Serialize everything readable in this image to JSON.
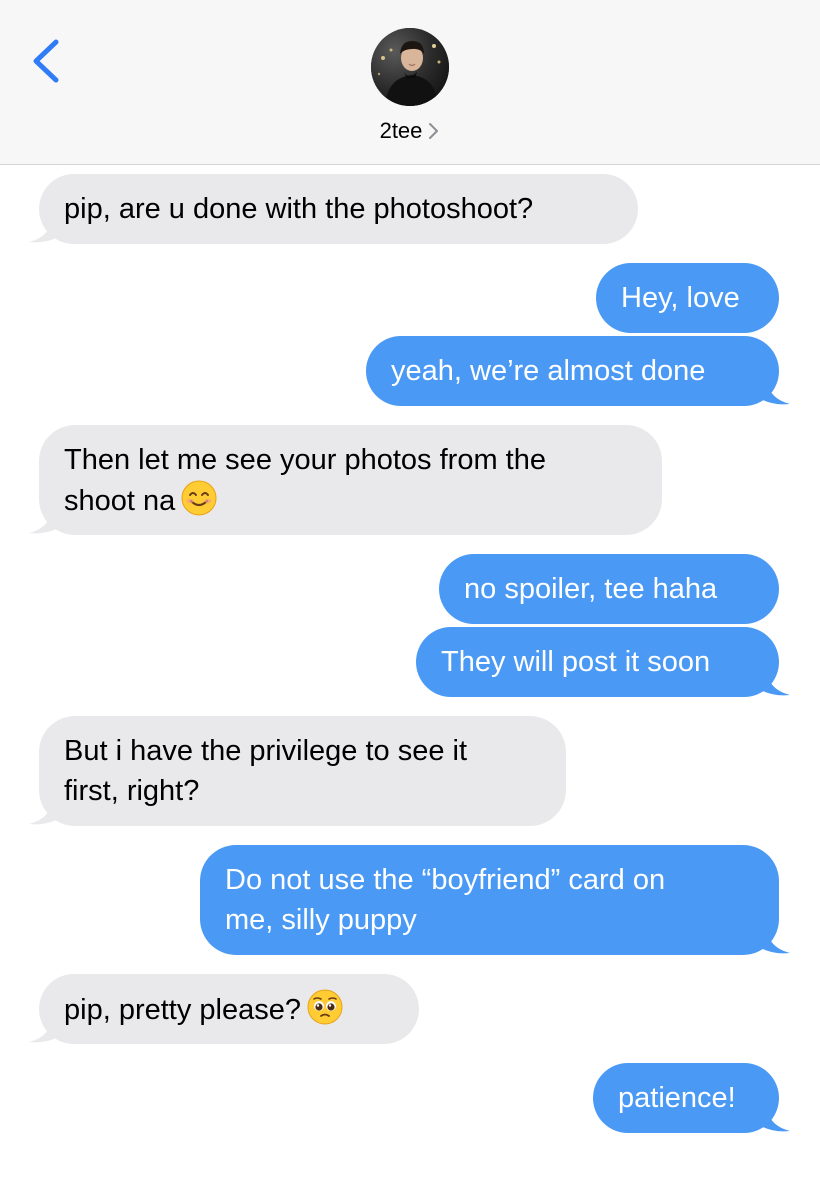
{
  "header": {
    "contact_name": "2tee"
  },
  "icons": {
    "back": "chevron-left-icon",
    "contact_chevron": "chevron-right-icon"
  },
  "colors": {
    "outgoing": "#4a99f4",
    "incoming": "#e9e9eb",
    "accent": "#2f7cf6"
  },
  "messages": [
    {
      "from": "them",
      "text": "pip, are u done with the photoshoot?"
    },
    {
      "from": "me",
      "text": "Hey, love"
    },
    {
      "from": "me",
      "text": "yeah, we’re almost done"
    },
    {
      "from": "them",
      "line1": "Then let me see your photos from the",
      "line2": "shoot na",
      "emoji": "smiling-face-emoji"
    },
    {
      "from": "me",
      "text": "no spoiler, tee haha"
    },
    {
      "from": "me",
      "text": "They will post it soon"
    },
    {
      "from": "them",
      "line1": "But i have the privilege to see it",
      "line2": "first, right?"
    },
    {
      "from": "me",
      "line1": "Do not use the “boyfriend” card on",
      "line2": "me, silly puppy"
    },
    {
      "from": "them",
      "text": "pip, pretty please?",
      "emoji": "pleading-face-emoji"
    },
    {
      "from": "me",
      "text": "patience!"
    }
  ]
}
